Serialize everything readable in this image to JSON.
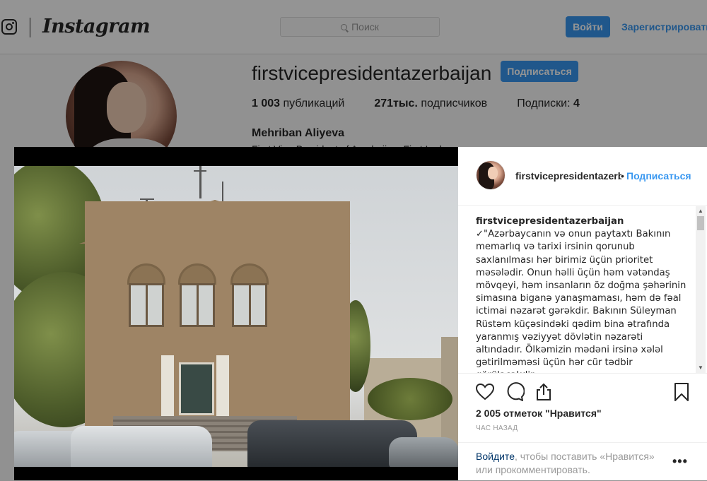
{
  "header": {
    "logo_text": "Instagram",
    "search_placeholder": "Поиск",
    "login_label": "Войти",
    "register_label": "Зарегистрироваться"
  },
  "profile": {
    "username": "firstvicepresidentazerbaijan",
    "follow_label": "Подписаться",
    "posts_count": "1 003",
    "posts_label": "публикаций",
    "followers_count": "271тыс.",
    "followers_label": "подписчиков",
    "following_label": "Подписки:",
    "following_count": "4",
    "full_name": "Mehriban Aliyeva",
    "bio_peek": "First Vice-President of Azerbaijan, First Lady"
  },
  "post": {
    "header_username": "firstvicepresidentazerbaijan",
    "header_dot": "•",
    "header_follow": "Подписаться",
    "caption_username": "firstvicepresidentazerbaijan",
    "caption_text": "✓\"Azərbaycanın və onun paytaxtı Bakının memarlıq və tarixi irsinin qorunub saxlanılması hər birimiz üçün prioritet məsələdir. Onun həlli üçün həm vətəndaş mövqeyi, həm insanların öz doğma şəhərinin simasına biganə yanaşmaması, həm də fəal ictimai nəzarət gərəkdir. Bakının Süleyman Rüstəm küçəsindəki qədim bina ətrafında yaranmış vəziyyət dövlətin nəzarəti altındadır. Ölkəmizin mədəni irsinə xələl gətirilməməsi üçün hər cür tədbir görüləcəkdir.",
    "likes_text": "2 005 отметок \"Нравится\"",
    "time_ago": "ЧАС НАЗАД",
    "login_link": "Войдите",
    "login_rest": ", чтобы поставить «Нравится» или прокомментировать.",
    "more_label": "•••"
  },
  "icons": {
    "like": "heart-icon",
    "comment": "comment-icon",
    "share": "share-icon",
    "save": "bookmark-icon"
  },
  "colors": {
    "accent": "#3897f0",
    "text": "#262626",
    "muted": "#999999"
  }
}
